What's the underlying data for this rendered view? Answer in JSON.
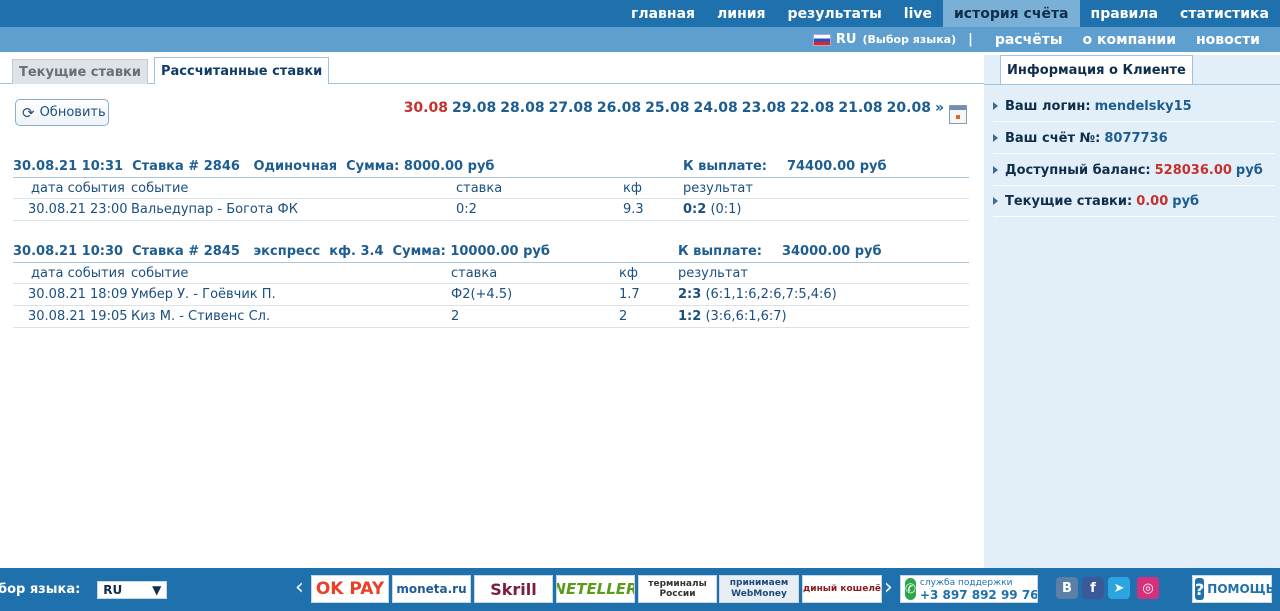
{
  "topnav": [
    {
      "label": "главная",
      "active": false
    },
    {
      "label": "линия",
      "active": false
    },
    {
      "label": "результаты",
      "active": false
    },
    {
      "label": "live",
      "active": false
    },
    {
      "label": "история счёта",
      "active": true
    },
    {
      "label": "правила",
      "active": false
    },
    {
      "label": "статистика",
      "active": false
    }
  ],
  "subnav": {
    "lang_code": "RU",
    "lang_choose": "(Выбор языка)",
    "separator": "|",
    "links": [
      "расчёты",
      "о компании",
      "новости"
    ]
  },
  "tabs": {
    "current_bets": "Текущие ставки",
    "settled_bets": "Рассчитанные ставки"
  },
  "toolbar": {
    "refresh_label": "Обновить",
    "dates": [
      "30.08",
      "29.08",
      "28.08",
      "27.08",
      "26.08",
      "25.08",
      "24.08",
      "23.08",
      "22.08",
      "21.08",
      "20.08"
    ],
    "more": "»"
  },
  "columns": {
    "date": "дата события",
    "event": "событие",
    "stake": "ставка",
    "coef": "кф",
    "result": "результат"
  },
  "bets": [
    {
      "header": "30.08.21 10:31  Ставка # 2846   Одиночная  Сумма: 8000.00 руб",
      "payout_label": "К выплате:",
      "payout_value": "74400.00 руб",
      "rows": [
        {
          "date": "30.08.21 23:00",
          "event": "Вальедупар - Богота ФК",
          "stake": "0:2",
          "coef": "9.3",
          "result_bold": "0:2",
          "result_detail": "(0:1)"
        }
      ]
    },
    {
      "header": "30.08.21 10:30  Ставка # 2845   экспресс  кф. 3.4  Сумма: 10000.00 руб",
      "payout_label": "К выплате:",
      "payout_value": "34000.00 руб",
      "rows": [
        {
          "date": "30.08.21 18:09",
          "event": "Умбер У. - Гоёвчик П.",
          "stake": "Ф2(+4.5)",
          "coef": "1.7",
          "result_bold": "2:3",
          "result_detail": "(6:1,1:6,2:6,7:5,4:6)"
        },
        {
          "date": "30.08.21 19:05",
          "event": "Киз М. - Стивенс Сл.",
          "stake": "2",
          "coef": "2",
          "result_bold": "1:2",
          "result_detail": "(3:6,6:1,6:7)"
        }
      ]
    }
  ],
  "client": {
    "tab_label": "Информация о Клиенте",
    "login_label": "Ваш логин:",
    "login_value": "mendelsky15",
    "account_label": "Ваш счёт №:",
    "account_value": "8077736",
    "balance_label": "Доступный баланс:",
    "balance_value": "528036.00",
    "balance_currency": "руб",
    "current_bets_label": "Текущие ставки:",
    "current_bets_value": "0.00",
    "current_bets_currency": "руб"
  },
  "footer": {
    "lang_label": "бор языка:",
    "lang_value": "RU",
    "payments": [
      "OK PAY",
      "moneta.ru",
      "Skrill",
      "NETELLER",
      "терминалы России",
      "принимаем WebMoney",
      "единый кошелёк"
    ],
    "support_label": "служба поддержки",
    "support_phone": "+3 897 892 99 76",
    "socials": [
      "В",
      "f"
    ],
    "help_label": "ПОМОЩЬ"
  },
  "colors": {
    "brand": "#1f71ad",
    "accent_red": "#c3322f",
    "link_blue": "#1d5d91"
  }
}
